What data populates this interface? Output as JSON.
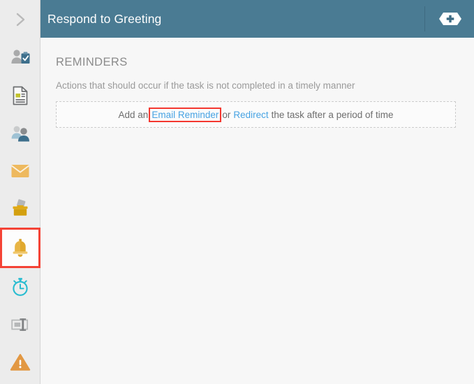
{
  "header": {
    "title": "Respond to Greeting",
    "add_button_label": "+",
    "add_button_icon": "plus-hexagon-icon",
    "background_color": "#4a7b93"
  },
  "sidebar": {
    "collapse_icon": "chevron-right-icon",
    "background_color": "#ececec",
    "selected_highlight_color": "#f44336",
    "items": [
      {
        "name": "collapse-toggle",
        "icon": "chevron-right-icon",
        "label": "Expand",
        "selected": false
      },
      {
        "name": "assignment",
        "icon": "person-clipboard-icon",
        "label": "Assignment",
        "selected": false
      },
      {
        "name": "form",
        "icon": "document-form-icon",
        "label": "Form",
        "selected": false
      },
      {
        "name": "participants",
        "icon": "two-people-icon",
        "label": "Participants",
        "selected": false
      },
      {
        "name": "email",
        "icon": "envelope-icon",
        "label": "Email",
        "selected": false
      },
      {
        "name": "submission",
        "icon": "inbox-drop-icon",
        "label": "Submission",
        "selected": false
      },
      {
        "name": "reminders",
        "icon": "bell-icon",
        "label": "Reminders",
        "selected": true
      },
      {
        "name": "deadline",
        "icon": "stopwatch-icon",
        "label": "Deadline",
        "selected": false
      },
      {
        "name": "fields",
        "icon": "text-field-icon",
        "label": "Fields",
        "selected": false
      },
      {
        "name": "escalation",
        "icon": "warning-triangle-icon",
        "label": "Escalation",
        "selected": false
      }
    ]
  },
  "main": {
    "section_title": "REMINDERS",
    "section_description": "Actions that should occur if the task is not completed in a timely manner",
    "dropzone": {
      "prefix_text": "Add an",
      "link_email": "Email Reminder",
      "middle_text": "or",
      "link_redirect": "Redirect",
      "suffix_text": "the task after a period of time",
      "link_color": "#47a3e3",
      "highlight_color": "#f4372f"
    }
  }
}
